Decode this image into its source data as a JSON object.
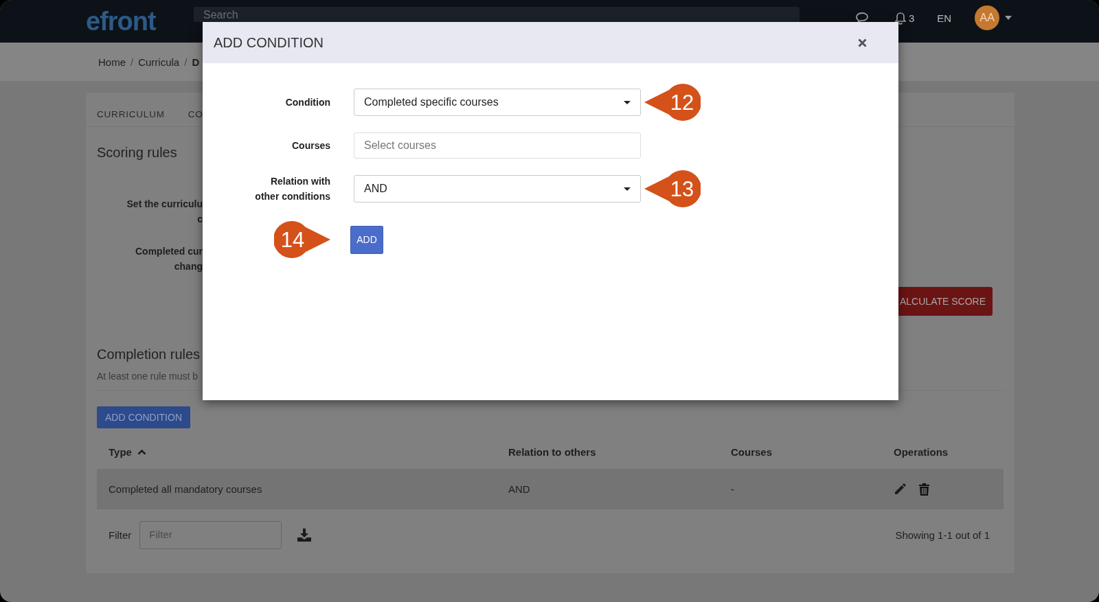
{
  "top_bar": {
    "logo": "efront",
    "search": {
      "placeholder": "Search"
    },
    "notifications": "3",
    "language": "EN",
    "avatar": "AA"
  },
  "breadcrumb": {
    "items": [
      "Home",
      "Curricula",
      "D"
    ],
    "separator": "/"
  },
  "tabs": [
    "CURRICULUM",
    "CO"
  ],
  "scoring_rules": {
    "title": "Scoring rules",
    "labels": [
      "Set the curriculu\nc",
      "Completed cur\nchang"
    ],
    "calculate_button": "ALCULATE SCORE"
  },
  "completion_rules": {
    "title": "Completion rules",
    "note": "At least one rule must b",
    "add_button": "ADD CONDITION",
    "table": {
      "columns": [
        {
          "label": "Type",
          "sorted": true
        },
        {
          "label": "Relation to others",
          "sorted": false
        },
        {
          "label": "Courses",
          "sorted": false
        },
        {
          "label": "Operations",
          "sorted": false
        }
      ],
      "rows": [
        {
          "cells": [
            "Completed all mandatory courses",
            "AND",
            "-"
          ]
        }
      ]
    },
    "filter": {
      "label": "Filter",
      "placeholder": "Filter"
    },
    "summary": "Showing 1-1 out of 1"
  },
  "modal": {
    "title": "ADD CONDITION",
    "fields": [
      {
        "label": "Condition",
        "kind": "dropdown",
        "value": "Completed specific courses",
        "callout": {
          "number": "12",
          "kind": "points-left"
        }
      },
      {
        "label": "Courses",
        "kind": "input",
        "placeholder": "Select courses"
      },
      {
        "label": "Relation with other conditions",
        "kind": "dropdown",
        "value": "AND",
        "callout": {
          "number": "13",
          "kind": "points-left"
        }
      }
    ],
    "add_button": {
      "label": "ADD",
      "callout": {
        "number": "14",
        "kind": "points-right"
      }
    }
  }
}
